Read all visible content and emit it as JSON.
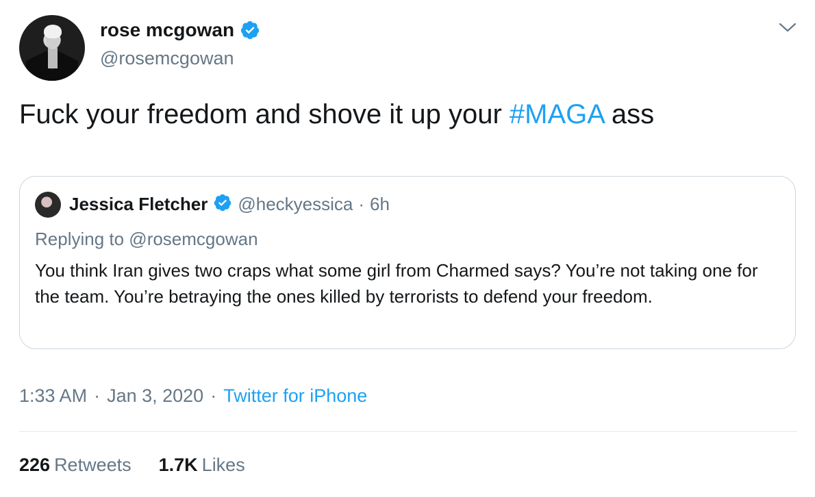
{
  "author": {
    "display_name": "rose mcgowan",
    "handle": "@rosemcgowan",
    "verified": true,
    "avatar_icon": "profile-photo"
  },
  "tweet": {
    "text_before": "Fuck your freedom and shove it up your ",
    "hashtag": "#MAGA",
    "text_after": " ass"
  },
  "quoted_tweet": {
    "display_name": "Jessica Fletcher",
    "handle": "@heckyessica",
    "separator": "·",
    "time": "6h",
    "replying_to": "Replying to @rosemcgowan",
    "text": "You think Iran gives two craps what some girl from Charmed says? You’re not taking one for the team. You’re betraying the ones killed by terrorists to defend your freedom."
  },
  "meta": {
    "time": "1:33 AM",
    "sep1": "·",
    "date": "Jan 3, 2020",
    "sep2": "·",
    "source": "Twitter for iPhone"
  },
  "stats": {
    "retweets_count": "226",
    "retweets_label": "Retweets",
    "likes_count": "1.7K",
    "likes_label": "Likes"
  },
  "colors": {
    "accent": "#1da1f2",
    "text": "#14171a",
    "secondary": "#657786",
    "border": "#ccd6dd"
  }
}
